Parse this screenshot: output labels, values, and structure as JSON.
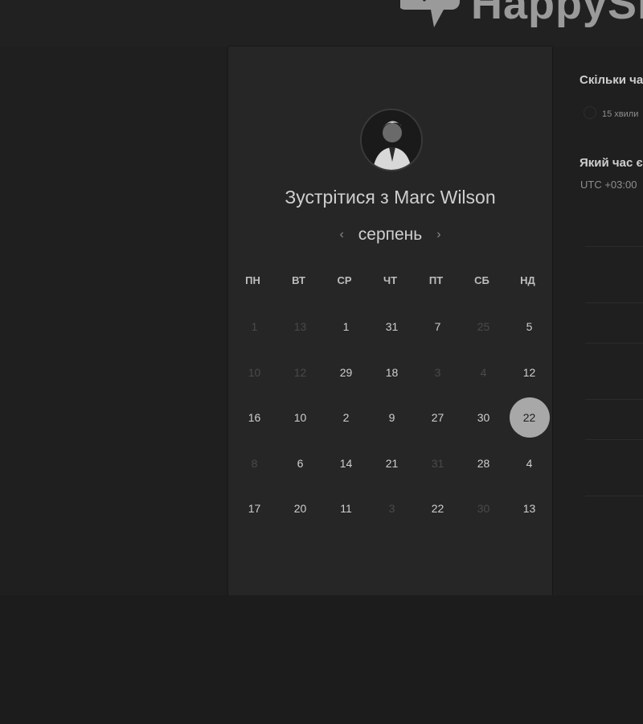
{
  "brand": {
    "name": "HappySign"
  },
  "meeting": {
    "title": "Зустрітися з Marc Wilson",
    "month": "серпень",
    "prev_label": "‹",
    "next_label": "›"
  },
  "calendar": {
    "weekdays": [
      "ПН",
      "ВТ",
      "СР",
      "ЧТ",
      "ПТ",
      "СБ",
      "НД"
    ],
    "weeks": [
      [
        {
          "d": "1",
          "on": false
        },
        {
          "d": "13",
          "on": false
        },
        {
          "d": "1",
          "on": true
        },
        {
          "d": "31",
          "on": true
        },
        {
          "d": "7",
          "on": true
        },
        {
          "d": "25",
          "on": false
        },
        {
          "d": "5",
          "on": true
        }
      ],
      [
        {
          "d": "10",
          "on": false
        },
        {
          "d": "12",
          "on": false
        },
        {
          "d": "29",
          "on": true
        },
        {
          "d": "18",
          "on": true
        },
        {
          "d": "3",
          "on": false
        },
        {
          "d": "4",
          "on": false
        },
        {
          "d": "12",
          "on": true
        }
      ],
      [
        {
          "d": "16",
          "on": true
        },
        {
          "d": "10",
          "on": true
        },
        {
          "d": "2",
          "on": true
        },
        {
          "d": "9",
          "on": true
        },
        {
          "d": "27",
          "on": true
        },
        {
          "d": "30",
          "on": true
        },
        {
          "d": "22",
          "on": true,
          "selected": true
        }
      ],
      [
        {
          "d": "8",
          "on": false
        },
        {
          "d": "6",
          "on": true
        },
        {
          "d": "14",
          "on": true
        },
        {
          "d": "21",
          "on": true
        },
        {
          "d": "31",
          "on": false
        },
        {
          "d": "28",
          "on": true
        },
        {
          "d": "4",
          "on": true
        }
      ],
      [
        {
          "d": "17",
          "on": true
        },
        {
          "d": "20",
          "on": true
        },
        {
          "d": "11",
          "on": true
        },
        {
          "d": "3",
          "on": false
        },
        {
          "d": "22",
          "on": true
        },
        {
          "d": "30",
          "on": false
        },
        {
          "d": "13",
          "on": true
        }
      ]
    ]
  },
  "sidebar": {
    "duration_heading": "Скільки ча",
    "duration_option": "15 хвили",
    "timezone_heading": "Який час є",
    "timezone_value": "UTC +03:00"
  },
  "colors": {
    "background": "#1c1c1c",
    "card": "#262626",
    "selected_day": "#a8a8a8",
    "disabled_day": "#4a4a4a"
  },
  "icons": {
    "logo": "speech-bubble-check-icon",
    "avatar": "person-photo"
  }
}
